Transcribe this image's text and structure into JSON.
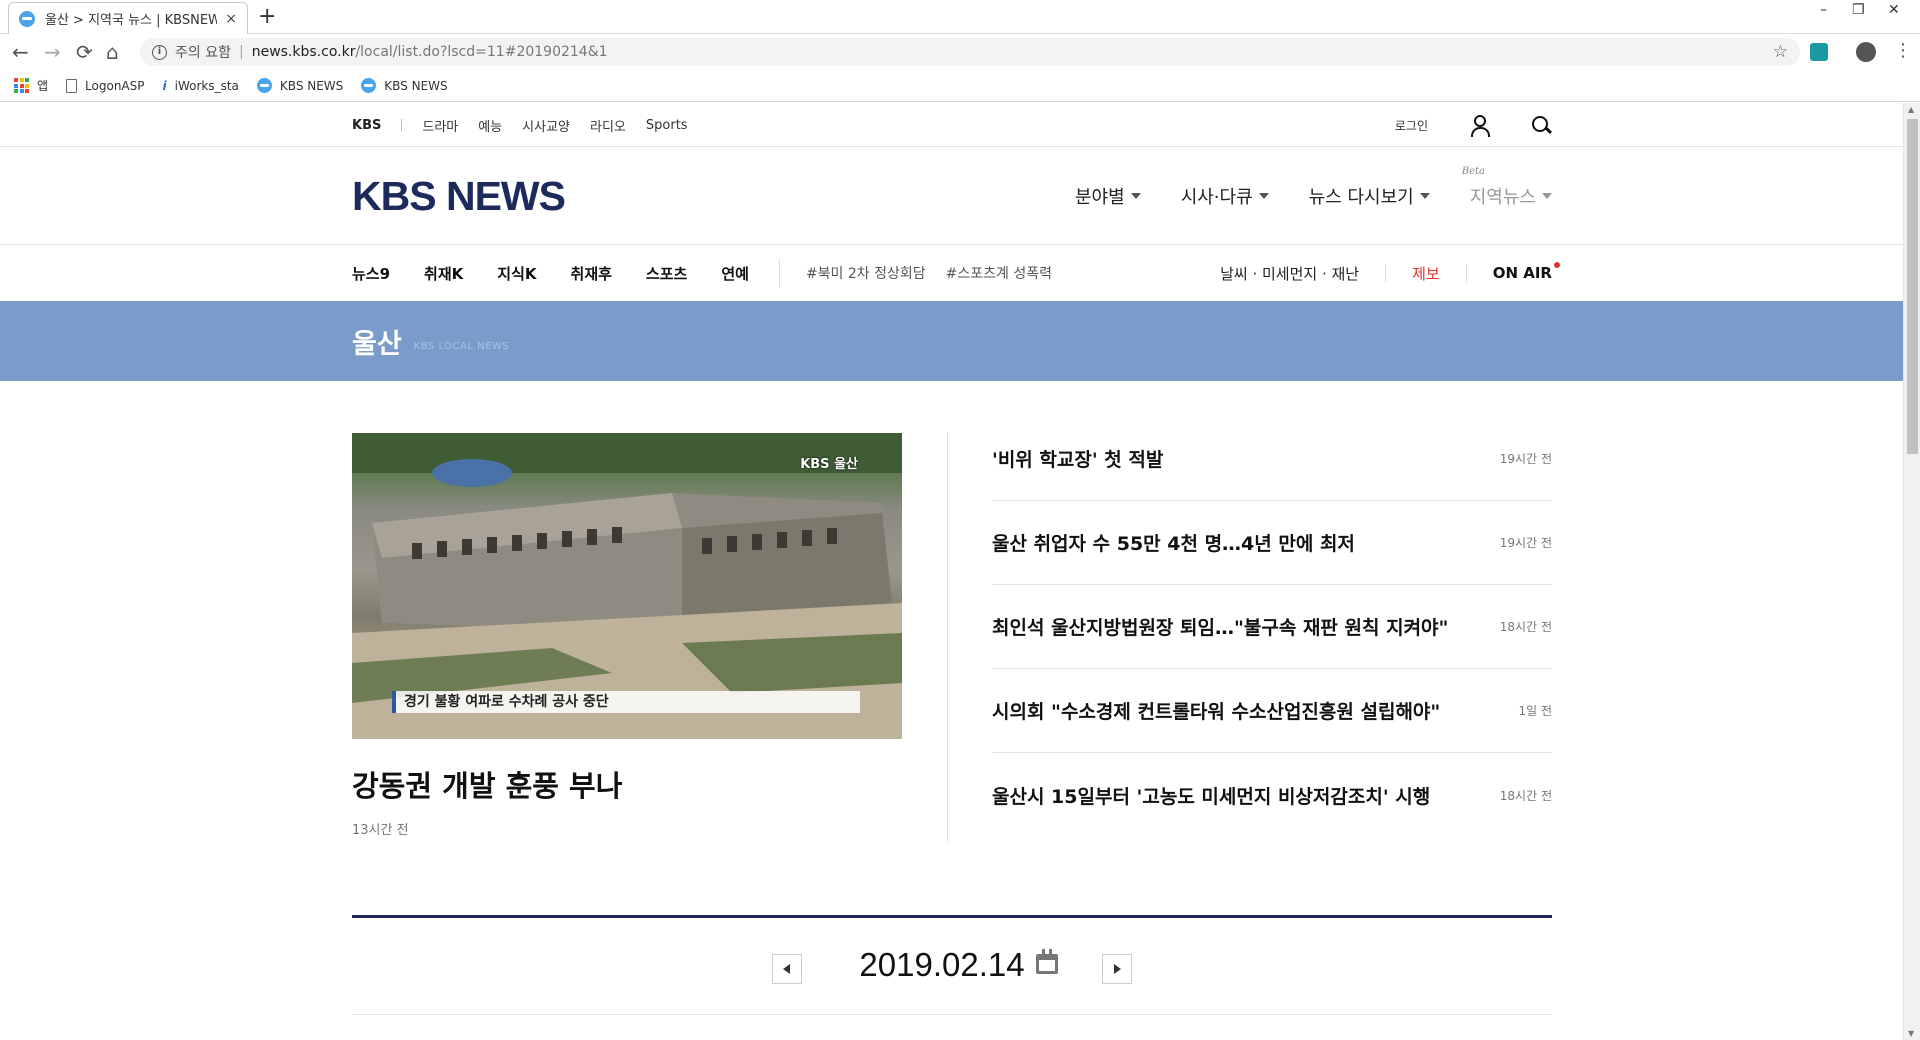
{
  "browser": {
    "tab_title": "울산 > 지역국 뉴스 | KBSNEWS",
    "tab_close": "×",
    "new_tab": "+",
    "window_controls": [
      "–",
      "❐",
      "✕"
    ],
    "nav": {
      "back": "←",
      "forward": "→",
      "reload": "⟳",
      "home": "⌂"
    },
    "address": {
      "security_label": "주의 요함",
      "separator": "|",
      "host": "news.kbs.co.kr",
      "path": "/local/list.do?lscd=11#20190214&1",
      "bookmark_star": "☆"
    },
    "menu": "⋮",
    "bookmarks": [
      {
        "label": "앱",
        "icon": "apps-icon"
      },
      {
        "label": "LogonASP",
        "icon": "page-icon"
      },
      {
        "label": "iWorks_sta",
        "icon": "iworks-icon"
      },
      {
        "label": "KBS NEWS",
        "icon": "kbs-favicon"
      },
      {
        "label": "KBS NEWS",
        "icon": "kbs-favicon"
      }
    ]
  },
  "topbar": {
    "kbs": "KBS",
    "links": [
      "드라마",
      "예능",
      "시사교양",
      "라디오",
      "Sports"
    ],
    "login": "로그인"
  },
  "header": {
    "logo": "KBS NEWS",
    "nav": [
      "분야별",
      "시사·다큐",
      "뉴스 다시보기",
      "지역뉴스"
    ],
    "beta": "Beta"
  },
  "subnav": {
    "items": [
      "뉴스9",
      "취재K",
      "지식K",
      "취재후",
      "스포츠",
      "연예"
    ],
    "tags": [
      "#북미 2차 정상회담",
      "#스포츠계 성폭력"
    ],
    "weather": "날씨 · 미세먼지 · 재난",
    "report": "제보",
    "onair": "ON AIR"
  },
  "banner": {
    "region": "울산",
    "subtitle": "KBS LOCAL NEWS"
  },
  "feature": {
    "watermark": "KBS 울산",
    "caption": "경기 불황 여파로 수차례 공사 중단",
    "headline": "강동권 개발 훈풍 부나",
    "time": "13시간 전"
  },
  "news_list": [
    {
      "title": "'비위 학교장' 첫 적발",
      "time": "19시간 전"
    },
    {
      "title": "울산 취업자 수 55만 4천 명…4년 만에 최저",
      "time": "19시간 전"
    },
    {
      "title": "최인석 울산지방법원장 퇴임…\"불구속 재판 원칙 지켜야\"",
      "time": "18시간 전"
    },
    {
      "title": "시의회 \"수소경제 컨트롤타워 수소산업진흥원 설립해야\"",
      "time": "1일 전"
    },
    {
      "title": "울산시 15일부터 '고농도 미세먼지 비상저감조치' 시행",
      "time": "18시간 전"
    }
  ],
  "datebar": {
    "date": "2019.02.14"
  },
  "colors": {
    "brand_navy": "#1c2a5c",
    "banner_blue": "#7b9ccb",
    "accent_red": "#e2342b"
  }
}
